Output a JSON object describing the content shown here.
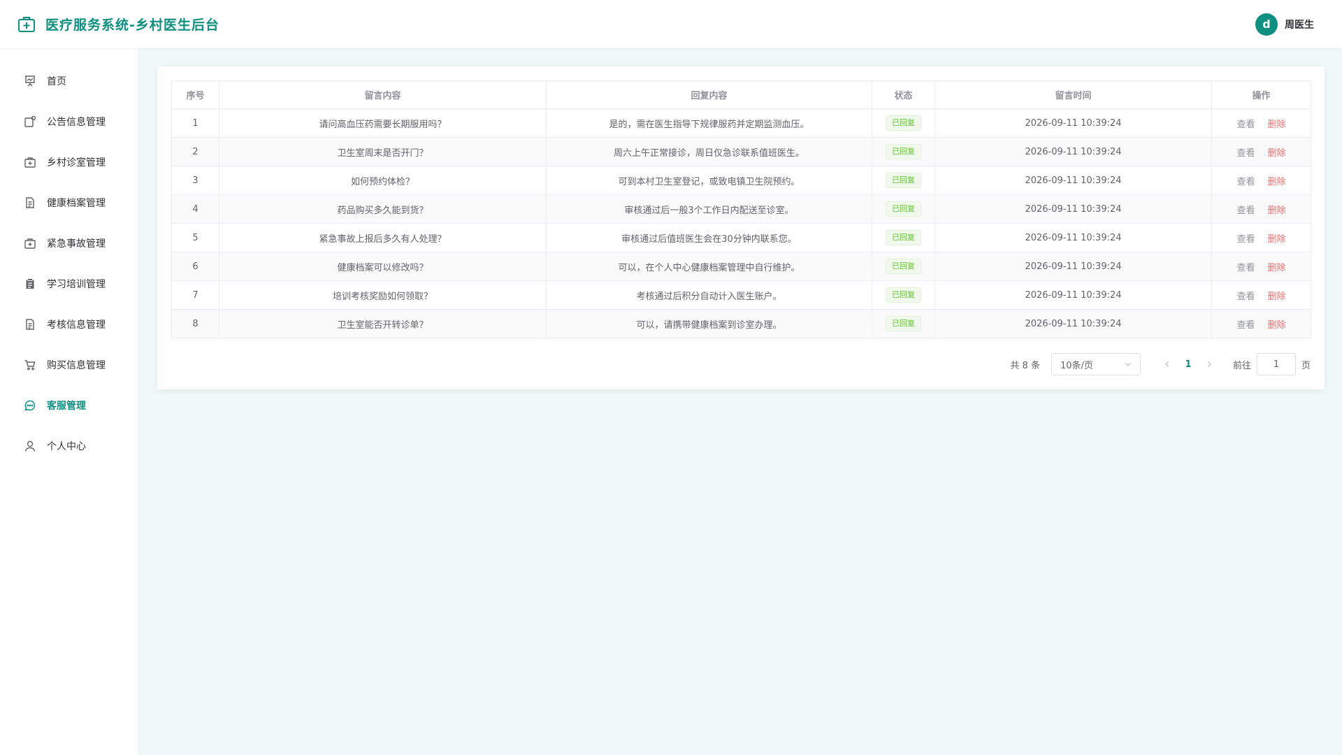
{
  "header": {
    "title": "医疗服务系统-乡村医生后台",
    "avatar_letter": "d",
    "user_name": "周医生"
  },
  "sidebar": {
    "items": [
      {
        "label": "首页",
        "icon": "presentation-icon"
      },
      {
        "label": "公告信息管理",
        "icon": "notice-icon"
      },
      {
        "label": "乡村诊室管理",
        "icon": "medkit-icon"
      },
      {
        "label": "健康档案管理",
        "icon": "document-icon"
      },
      {
        "label": "紧急事故管理",
        "icon": "emergency-kit-icon"
      },
      {
        "label": "学习培训管理",
        "icon": "clipboard-icon"
      },
      {
        "label": "考核信息管理",
        "icon": "file-icon"
      },
      {
        "label": "购买信息管理",
        "icon": "cart-icon"
      },
      {
        "label": "客服管理",
        "icon": "chat-icon",
        "active": true
      },
      {
        "label": "个人中心",
        "icon": "user-icon"
      }
    ]
  },
  "table": {
    "headers": [
      "序号",
      "留言内容",
      "回复内容",
      "状态",
      "留言时间",
      "操作"
    ],
    "view_label": "查看",
    "delete_label": "删除",
    "rows": [
      {
        "no": "1",
        "message": "请问高血压药需要长期服用吗？",
        "reply": "是的，需在医生指导下规律服药并定期监测血压。",
        "status": "已回复",
        "time": "2026-09-11 10:39:24"
      },
      {
        "no": "2",
        "message": "卫生室周末是否开门？",
        "reply": "周六上午正常接诊，周日仅急诊联系值班医生。",
        "status": "已回复",
        "time": "2026-09-11 10:39:24"
      },
      {
        "no": "3",
        "message": "如何预约体检？",
        "reply": "可到本村卫生室登记，或致电镇卫生院预约。",
        "status": "已回复",
        "time": "2026-09-11 10:39:24"
      },
      {
        "no": "4",
        "message": "药品购买多久能到货？",
        "reply": "审核通过后一般3个工作日内配送至诊室。",
        "status": "已回复",
        "time": "2026-09-11 10:39:24"
      },
      {
        "no": "5",
        "message": "紧急事故上报后多久有人处理？",
        "reply": "审核通过后值班医生会在30分钟内联系您。",
        "status": "已回复",
        "time": "2026-09-11 10:39:24"
      },
      {
        "no": "6",
        "message": "健康档案可以修改吗？",
        "reply": "可以，在个人中心健康档案管理中自行维护。",
        "status": "已回复",
        "time": "2026-09-11 10:39:24"
      },
      {
        "no": "7",
        "message": "培训考核奖励如何领取？",
        "reply": "考核通过后积分自动计入医生账户。",
        "status": "已回复",
        "time": "2026-09-11 10:39:24"
      },
      {
        "no": "8",
        "message": "卫生室能否开转诊单？",
        "reply": "可以，请携带健康档案到诊室办理。",
        "status": "已回复",
        "time": "2026-09-11 10:39:24"
      }
    ]
  },
  "pagination": {
    "total_text": "共 8 条",
    "page_size": "10条/页",
    "current_page": "1",
    "goto_label": "前往",
    "goto_value": "1",
    "goto_suffix": "页"
  },
  "colors": {
    "accent": "#0f8f80",
    "success": "#67c23a",
    "danger": "#f56c6c",
    "background": "#f0faf8"
  }
}
